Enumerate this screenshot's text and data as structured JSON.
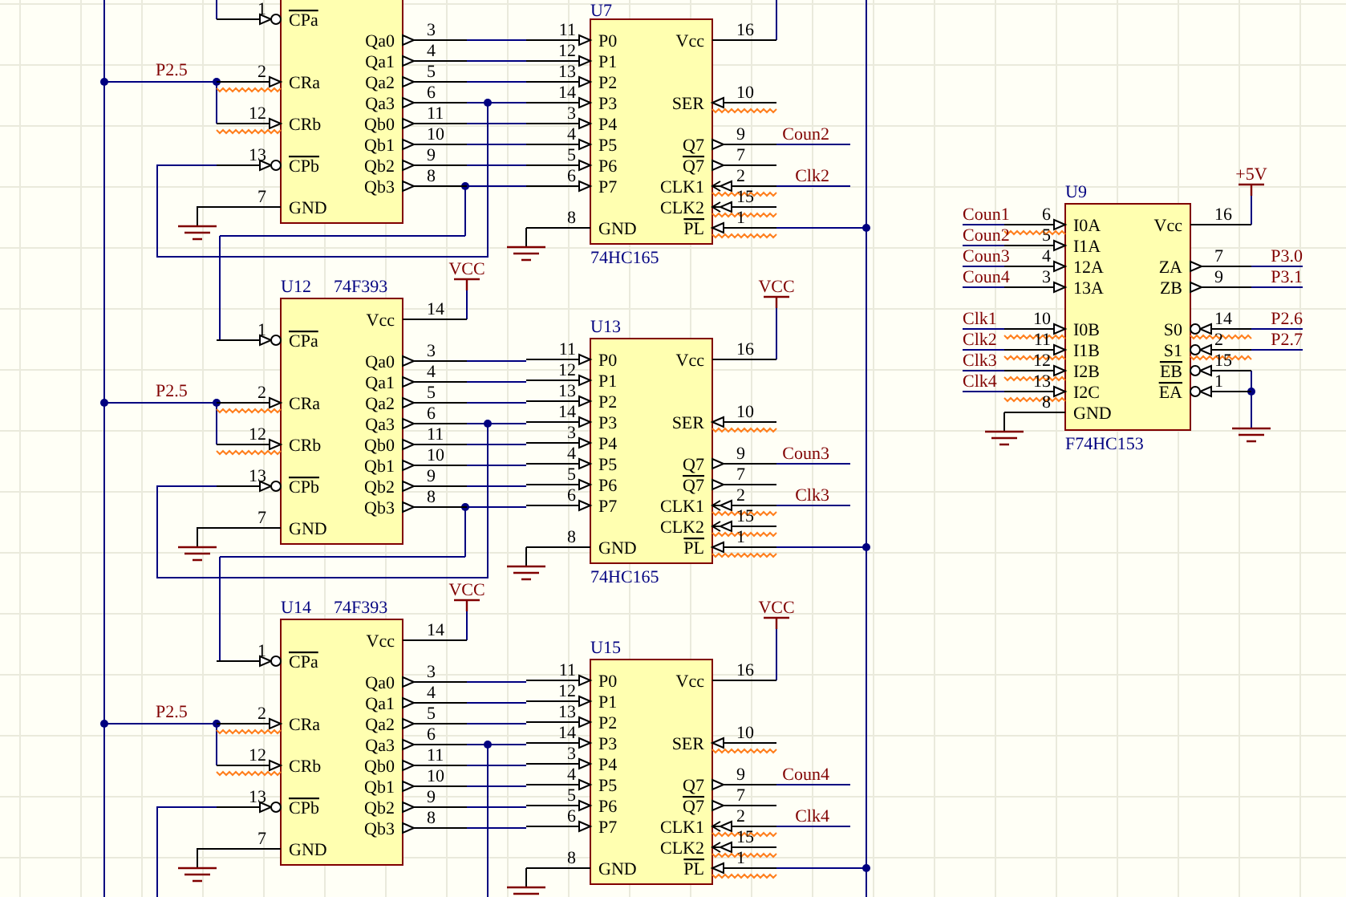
{
  "chips": [
    {
      "kind": "counter",
      "left_pins": [
        {
          "number": "1",
          "label": "CPa",
          "kind": "input",
          "overbar": true,
          "inverted": true,
          "flagged": false
        },
        {
          "number": "2",
          "label": "CRa",
          "kind": "input",
          "overbar": false,
          "inverted": false,
          "flagged": true,
          "net": "P2.5"
        },
        {
          "number": "12",
          "label": "CRb",
          "kind": "input",
          "overbar": false,
          "inverted": false,
          "flagged": true
        },
        {
          "number": "13",
          "label": "CPb",
          "kind": "input",
          "overbar": true,
          "inverted": true,
          "flagged": false
        },
        {
          "number": "7",
          "label": "GND",
          "kind": "ground",
          "overbar": false,
          "inverted": false,
          "flagged": false
        }
      ],
      "right_pins": [
        {
          "number": "3",
          "label": "Qa0",
          "kind": "output",
          "overbar": false,
          "inverted": false,
          "flagged": false
        },
        {
          "number": "4",
          "label": "Qa1",
          "kind": "output",
          "overbar": false,
          "inverted": false,
          "flagged": false
        },
        {
          "number": "5",
          "label": "Qa2",
          "kind": "output",
          "overbar": false,
          "inverted": false,
          "flagged": false
        },
        {
          "number": "6",
          "label": "Qa3",
          "kind": "output",
          "overbar": false,
          "inverted": false,
          "flagged": false
        },
        {
          "number": "11",
          "label": "Qb0",
          "kind": "output",
          "overbar": false,
          "inverted": false,
          "flagged": false
        },
        {
          "number": "10",
          "label": "Qb1",
          "kind": "output",
          "overbar": false,
          "inverted": false,
          "flagged": false
        },
        {
          "number": "9",
          "label": "Qb2",
          "kind": "output",
          "overbar": false,
          "inverted": false,
          "flagged": false
        },
        {
          "number": "8",
          "label": "Qb3",
          "kind": "output",
          "overbar": false,
          "inverted": false,
          "flagged": false
        }
      ]
    },
    {
      "kind": "shift_register",
      "designator": "U7",
      "part": "74HC165",
      "left_pins": [
        {
          "number": "11",
          "label": "P0",
          "kind": "input",
          "overbar": false,
          "inverted": false,
          "flagged": false
        },
        {
          "number": "12",
          "label": "P1",
          "kind": "input",
          "overbar": false,
          "inverted": false,
          "flagged": false
        },
        {
          "number": "13",
          "label": "P2",
          "kind": "input",
          "overbar": false,
          "inverted": false,
          "flagged": false
        },
        {
          "number": "14",
          "label": "P3",
          "kind": "input",
          "overbar": false,
          "inverted": false,
          "flagged": false
        },
        {
          "number": "3",
          "label": "P4",
          "kind": "input",
          "overbar": false,
          "inverted": false,
          "flagged": false
        },
        {
          "number": "4",
          "label": "P5",
          "kind": "input",
          "overbar": false,
          "inverted": false,
          "flagged": false
        },
        {
          "number": "5",
          "label": "P6",
          "kind": "input",
          "overbar": false,
          "inverted": false,
          "flagged": false
        },
        {
          "number": "6",
          "label": "P7",
          "kind": "input",
          "overbar": false,
          "inverted": false,
          "flagged": false
        },
        {
          "number": "8",
          "label": "GND",
          "kind": "ground",
          "overbar": false,
          "inverted": false,
          "flagged": false
        }
      ],
      "right_pins": [
        {
          "number": "16",
          "label": "Vcc",
          "kind": "power",
          "overbar": false,
          "inverted": false,
          "flagged": false
        },
        {
          "number": "10",
          "label": "SER",
          "kind": "input",
          "overbar": false,
          "inverted": false,
          "flagged": true
        },
        {
          "number": "9",
          "label": "Q7",
          "kind": "output",
          "overbar": false,
          "inverted": false,
          "flagged": false,
          "net": "Coun2"
        },
        {
          "number": "7",
          "label": "Q7",
          "kind": "output",
          "overbar": true,
          "inverted": false,
          "flagged": false
        },
        {
          "number": "2",
          "label": "CLK1",
          "kind": "clock",
          "overbar": false,
          "inverted": false,
          "flagged": true,
          "net": "Clk2"
        },
        {
          "number": "15",
          "label": "CLK2",
          "kind": "clock",
          "overbar": false,
          "inverted": false,
          "flagged": true
        },
        {
          "number": "1",
          "label": "PL",
          "kind": "input",
          "overbar": true,
          "inverted": false,
          "flagged": true
        }
      ]
    },
    {
      "kind": "counter",
      "designator": "U12",
      "part": "74F393",
      "left_pins": [
        {
          "number": "1",
          "label": "CPa",
          "kind": "input",
          "overbar": true,
          "inverted": true,
          "flagged": false
        },
        {
          "number": "2",
          "label": "CRa",
          "kind": "input",
          "overbar": false,
          "inverted": false,
          "flagged": true,
          "net": "P2.5"
        },
        {
          "number": "12",
          "label": "CRb",
          "kind": "input",
          "overbar": false,
          "inverted": false,
          "flagged": true
        },
        {
          "number": "13",
          "label": "CPb",
          "kind": "input",
          "overbar": true,
          "inverted": true,
          "flagged": false
        },
        {
          "number": "7",
          "label": "GND",
          "kind": "ground",
          "overbar": false,
          "inverted": false,
          "flagged": false
        }
      ],
      "right_pins": [
        {
          "number": "14",
          "label": "Vcc",
          "kind": "power",
          "overbar": false,
          "inverted": false,
          "flagged": false,
          "supply": "VCC"
        },
        {
          "number": "3",
          "label": "Qa0",
          "kind": "output",
          "overbar": false,
          "inverted": false,
          "flagged": false
        },
        {
          "number": "4",
          "label": "Qa1",
          "kind": "output",
          "overbar": false,
          "inverted": false,
          "flagged": false
        },
        {
          "number": "5",
          "label": "Qa2",
          "kind": "output",
          "overbar": false,
          "inverted": false,
          "flagged": false
        },
        {
          "number": "6",
          "label": "Qa3",
          "kind": "output",
          "overbar": false,
          "inverted": false,
          "flagged": false
        },
        {
          "number": "11",
          "label": "Qb0",
          "kind": "output",
          "overbar": false,
          "inverted": false,
          "flagged": false
        },
        {
          "number": "10",
          "label": "Qb1",
          "kind": "output",
          "overbar": false,
          "inverted": false,
          "flagged": false
        },
        {
          "number": "9",
          "label": "Qb2",
          "kind": "output",
          "overbar": false,
          "inverted": false,
          "flagged": false
        },
        {
          "number": "8",
          "label": "Qb3",
          "kind": "output",
          "overbar": false,
          "inverted": false,
          "flagged": false
        }
      ]
    },
    {
      "kind": "shift_register",
      "designator": "U13",
      "part": "74HC165",
      "left_pins": [
        {
          "number": "11",
          "label": "P0",
          "kind": "input",
          "overbar": false,
          "inverted": false,
          "flagged": false
        },
        {
          "number": "12",
          "label": "P1",
          "kind": "input",
          "overbar": false,
          "inverted": false,
          "flagged": false
        },
        {
          "number": "13",
          "label": "P2",
          "kind": "input",
          "overbar": false,
          "inverted": false,
          "flagged": false
        },
        {
          "number": "14",
          "label": "P3",
          "kind": "input",
          "overbar": false,
          "inverted": false,
          "flagged": false
        },
        {
          "number": "3",
          "label": "P4",
          "kind": "input",
          "overbar": false,
          "inverted": false,
          "flagged": false
        },
        {
          "number": "4",
          "label": "P5",
          "kind": "input",
          "overbar": false,
          "inverted": false,
          "flagged": false
        },
        {
          "number": "5",
          "label": "P6",
          "kind": "input",
          "overbar": false,
          "inverted": false,
          "flagged": false
        },
        {
          "number": "6",
          "label": "P7",
          "kind": "input",
          "overbar": false,
          "inverted": false,
          "flagged": false
        },
        {
          "number": "8",
          "label": "GND",
          "kind": "ground",
          "overbar": false,
          "inverted": false,
          "flagged": false
        }
      ],
      "right_pins": [
        {
          "number": "16",
          "label": "Vcc",
          "kind": "power",
          "overbar": false,
          "inverted": false,
          "flagged": false,
          "supply": "VCC"
        },
        {
          "number": "10",
          "label": "SER",
          "kind": "input",
          "overbar": false,
          "inverted": false,
          "flagged": true
        },
        {
          "number": "9",
          "label": "Q7",
          "kind": "output",
          "overbar": false,
          "inverted": false,
          "flagged": false,
          "net": "Coun3"
        },
        {
          "number": "7",
          "label": "Q7",
          "kind": "output",
          "overbar": true,
          "inverted": false,
          "flagged": false
        },
        {
          "number": "2",
          "label": "CLK1",
          "kind": "clock",
          "overbar": false,
          "inverted": false,
          "flagged": true,
          "net": "Clk3"
        },
        {
          "number": "15",
          "label": "CLK2",
          "kind": "clock",
          "overbar": false,
          "inverted": false,
          "flagged": true
        },
        {
          "number": "1",
          "label": "PL",
          "kind": "input",
          "overbar": true,
          "inverted": false,
          "flagged": true
        }
      ]
    },
    {
      "kind": "counter",
      "designator": "U14",
      "part": "74F393",
      "left_pins": [
        {
          "number": "1",
          "label": "CPa",
          "kind": "input",
          "overbar": true,
          "inverted": true,
          "flagged": false
        },
        {
          "number": "2",
          "label": "CRa",
          "kind": "input",
          "overbar": false,
          "inverted": false,
          "flagged": true,
          "net": "P2.5"
        },
        {
          "number": "12",
          "label": "CRb",
          "kind": "input",
          "overbar": false,
          "inverted": false,
          "flagged": true
        },
        {
          "number": "13",
          "label": "CPb",
          "kind": "input",
          "overbar": true,
          "inverted": true,
          "flagged": false
        },
        {
          "number": "7",
          "label": "GND",
          "kind": "ground",
          "overbar": false,
          "inverted": false,
          "flagged": false
        }
      ],
      "right_pins": [
        {
          "number": "14",
          "label": "Vcc",
          "kind": "power",
          "overbar": false,
          "inverted": false,
          "flagged": false,
          "supply": "VCC"
        },
        {
          "number": "3",
          "label": "Qa0",
          "kind": "output",
          "overbar": false,
          "inverted": false,
          "flagged": false
        },
        {
          "number": "4",
          "label": "Qa1",
          "kind": "output",
          "overbar": false,
          "inverted": false,
          "flagged": false
        },
        {
          "number": "5",
          "label": "Qa2",
          "kind": "output",
          "overbar": false,
          "inverted": false,
          "flagged": false
        },
        {
          "number": "6",
          "label": "Qa3",
          "kind": "output",
          "overbar": false,
          "inverted": false,
          "flagged": false
        },
        {
          "number": "11",
          "label": "Qb0",
          "kind": "output",
          "overbar": false,
          "inverted": false,
          "flagged": false
        },
        {
          "number": "10",
          "label": "Qb1",
          "kind": "output",
          "overbar": false,
          "inverted": false,
          "flagged": false
        },
        {
          "number": "9",
          "label": "Qb2",
          "kind": "output",
          "overbar": false,
          "inverted": false,
          "flagged": false
        },
        {
          "number": "8",
          "label": "Qb3",
          "kind": "output",
          "overbar": false,
          "inverted": false,
          "flagged": false
        }
      ]
    },
    {
      "kind": "shift_register",
      "designator": "U15",
      "left_pins": [
        {
          "number": "11",
          "label": "P0",
          "kind": "input",
          "overbar": false,
          "inverted": false,
          "flagged": false
        },
        {
          "number": "12",
          "label": "P1",
          "kind": "input",
          "overbar": false,
          "inverted": false,
          "flagged": false
        },
        {
          "number": "13",
          "label": "P2",
          "kind": "input",
          "overbar": false,
          "inverted": false,
          "flagged": false
        },
        {
          "number": "14",
          "label": "P3",
          "kind": "input",
          "overbar": false,
          "inverted": false,
          "flagged": false
        },
        {
          "number": "3",
          "label": "P4",
          "kind": "input",
          "overbar": false,
          "inverted": false,
          "flagged": false
        },
        {
          "number": "4",
          "label": "P5",
          "kind": "input",
          "overbar": false,
          "inverted": false,
          "flagged": false
        },
        {
          "number": "5",
          "label": "P6",
          "kind": "input",
          "overbar": false,
          "inverted": false,
          "flagged": false
        },
        {
          "number": "6",
          "label": "P7",
          "kind": "input",
          "overbar": false,
          "inverted": false,
          "flagged": false
        },
        {
          "number": "8",
          "label": "GND",
          "kind": "ground",
          "overbar": false,
          "inverted": false,
          "flagged": false
        }
      ],
      "right_pins": [
        {
          "number": "16",
          "label": "Vcc",
          "kind": "power",
          "overbar": false,
          "inverted": false,
          "flagged": false,
          "supply": "VCC"
        },
        {
          "number": "10",
          "label": "SER",
          "kind": "input",
          "overbar": false,
          "inverted": false,
          "flagged": true
        },
        {
          "number": "9",
          "label": "Q7",
          "kind": "output",
          "overbar": false,
          "inverted": false,
          "flagged": false,
          "net": "Coun4"
        },
        {
          "number": "7",
          "label": "Q7",
          "kind": "output",
          "overbar": true,
          "inverted": false,
          "flagged": false
        },
        {
          "number": "2",
          "label": "CLK1",
          "kind": "clock",
          "overbar": false,
          "inverted": false,
          "flagged": true,
          "net": "Clk4"
        },
        {
          "number": "15",
          "label": "CLK2",
          "kind": "clock",
          "overbar": false,
          "inverted": false,
          "flagged": true
        },
        {
          "number": "1",
          "label": "PL",
          "kind": "input",
          "overbar": true,
          "inverted": false,
          "flagged": true
        }
      ]
    },
    {
      "kind": "mux",
      "designator": "U9",
      "part": "F74HC153",
      "left_pins": [
        {
          "number": "6",
          "label": "I0A",
          "kind": "input",
          "overbar": false,
          "inverted": false,
          "flagged": true,
          "net": "Coun1"
        },
        {
          "number": "5",
          "label": "I1A",
          "kind": "input",
          "overbar": false,
          "inverted": false,
          "flagged": false,
          "net": "Coun2"
        },
        {
          "number": "4",
          "label": "12A",
          "kind": "input",
          "overbar": false,
          "inverted": false,
          "flagged": false,
          "net": "Coun3"
        },
        {
          "number": "3",
          "label": "13A",
          "kind": "input",
          "overbar": false,
          "inverted": false,
          "flagged": false,
          "net": "Coun4"
        },
        {
          "number": "10",
          "label": "I0B",
          "kind": "input",
          "overbar": false,
          "inverted": false,
          "flagged": true,
          "net": "Clk1"
        },
        {
          "number": "11",
          "label": "I1B",
          "kind": "input",
          "overbar": false,
          "inverted": false,
          "flagged": true,
          "net": "Clk2"
        },
        {
          "number": "12",
          "label": "I2B",
          "kind": "input",
          "overbar": false,
          "inverted": false,
          "flagged": true,
          "net": "Clk3"
        },
        {
          "number": "13",
          "label": "I2C",
          "kind": "input",
          "overbar": false,
          "inverted": false,
          "flagged": true,
          "net": "Clk4"
        },
        {
          "number": "8",
          "label": "GND",
          "kind": "ground",
          "overbar": false,
          "inverted": false,
          "flagged": false
        }
      ],
      "right_pins": [
        {
          "number": "16",
          "label": "Vcc",
          "kind": "power",
          "overbar": false,
          "inverted": false,
          "flagged": false,
          "supply": "+5V"
        },
        {
          "number": "7",
          "label": "ZA",
          "kind": "output",
          "overbar": false,
          "inverted": false,
          "flagged": false,
          "net": "P3.0"
        },
        {
          "number": "9",
          "label": "ZB",
          "kind": "output",
          "overbar": false,
          "inverted": false,
          "flagged": false,
          "net": "P3.1"
        },
        {
          "number": "14",
          "label": "S0",
          "kind": "input",
          "overbar": false,
          "inverted": true,
          "flagged": true,
          "net": "P2.6"
        },
        {
          "number": "2",
          "label": "S1",
          "kind": "input",
          "overbar": false,
          "inverted": true,
          "flagged": true,
          "net": "P2.7"
        },
        {
          "number": "15",
          "label": "EB",
          "kind": "input",
          "overbar": true,
          "inverted": true,
          "flagged": false
        },
        {
          "number": "1",
          "label": "EA",
          "kind": "input",
          "overbar": true,
          "inverted": true,
          "flagged": false
        }
      ]
    }
  ]
}
